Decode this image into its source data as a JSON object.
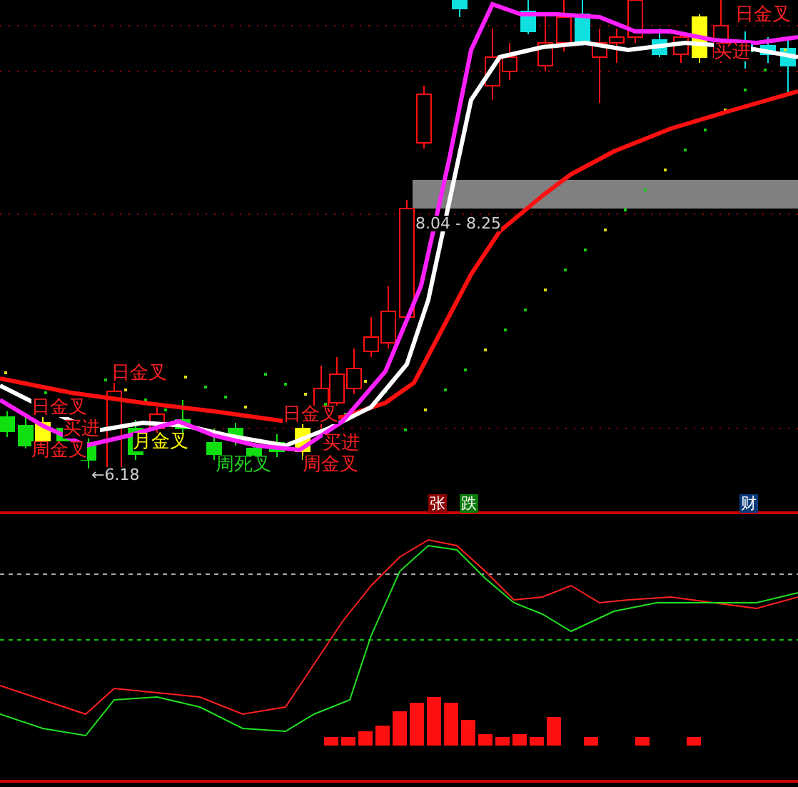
{
  "main_chart": {
    "labels": [
      {
        "text": "日金叉",
        "color": "#ff2020"
      },
      {
        "text": "日金叉",
        "color": "#ff2020"
      },
      {
        "text": "买进",
        "color": "#ff2020"
      },
      {
        "text": "周金叉",
        "color": "#ff2020"
      },
      {
        "text": "月金叉",
        "color": "#ffff00"
      },
      {
        "text": "周死叉",
        "color": "#20d020"
      },
      {
        "text": "日金叉",
        "color": "#ff2020"
      },
      {
        "text": "买进",
        "color": "#ff2020"
      },
      {
        "text": "周金叉",
        "color": "#ff2020"
      },
      {
        "text": "日金叉",
        "color": "#ff2020"
      },
      {
        "text": "买进",
        "color": "#ff2020"
      }
    ],
    "low_marker": "←6.18",
    "price_range": "8.04 - 8.25"
  },
  "indicator": {
    "buttons": [
      {
        "text": "张",
        "color": "#8b0000"
      },
      {
        "text": "跌",
        "color": "#0a7a0a"
      },
      {
        "text": "财",
        "color": "#0a3a7a"
      }
    ]
  }
}
